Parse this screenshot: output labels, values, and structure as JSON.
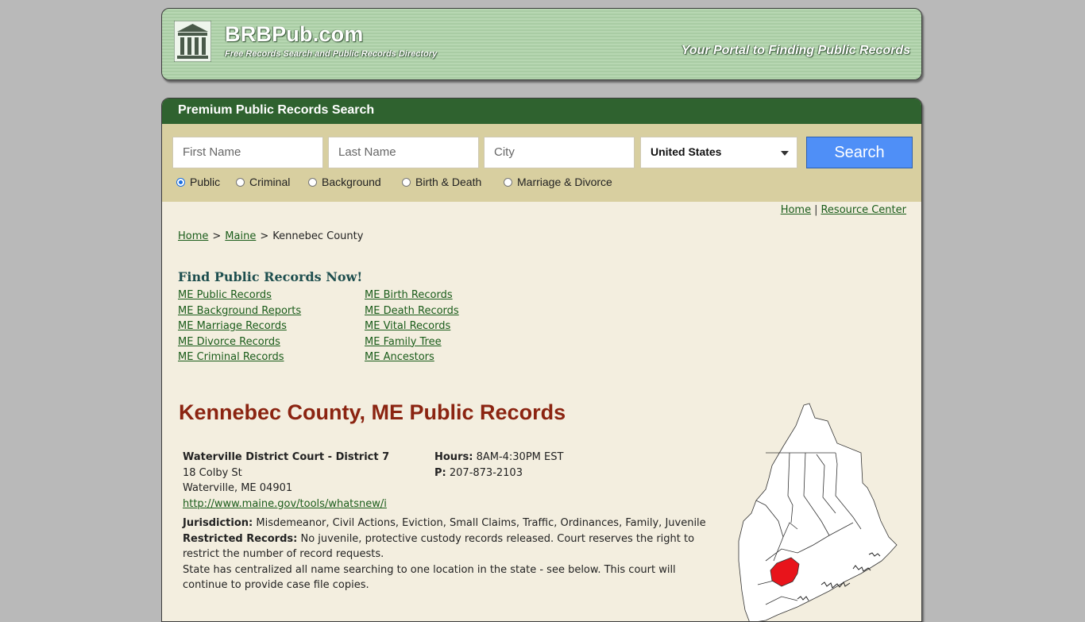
{
  "header": {
    "site_name": "BRBPub.com",
    "site_subtitle": "Free Records Search and Public Records Directory",
    "tagline": "Your Portal to Finding Public Records"
  },
  "search": {
    "title": "Premium Public Records Search",
    "first_name_placeholder": "First Name",
    "last_name_placeholder": "Last Name",
    "city_placeholder": "City",
    "country_selected": "United States",
    "button_label": "Search",
    "record_types": [
      {
        "label": "Public",
        "selected": true
      },
      {
        "label": "Criminal",
        "selected": false
      },
      {
        "label": "Background",
        "selected": false
      },
      {
        "label": "Birth & Death",
        "selected": false
      },
      {
        "label": "Marriage & Divorce",
        "selected": false
      }
    ]
  },
  "top_links": {
    "home": "Home",
    "separator": "|",
    "resource_center": "Resource Center"
  },
  "breadcrumb": {
    "home": "Home",
    "state": "Maine",
    "current": "Kennebec County",
    "separator": ">"
  },
  "find_records": {
    "title": "Find Public Records Now!",
    "left_links": [
      "ME Public Records",
      "ME Background Reports",
      "ME Marriage Records",
      "ME Divorce Records",
      "ME Criminal Records"
    ],
    "right_links": [
      "ME Birth Records",
      "ME Death Records",
      "ME Vital Records",
      "ME Family Tree",
      "ME Ancestors"
    ]
  },
  "county": {
    "title": "Kennebec County, ME Public Records",
    "court_name": "Waterville District Court - District 7",
    "address_line1": "18 Colby St",
    "address_line2": "Waterville, ME 04901",
    "url": "http://www.maine.gov/tools/whatsnew/i",
    "hours_label": "Hours:",
    "hours_value": "8AM-4:30PM EST",
    "phone_label": "P:",
    "phone_value": "207-873-2103",
    "jurisdiction_label": "Jurisdiction:",
    "jurisdiction_value": "Misdemeanor, Civil Actions, Eviction, Small Claims, Traffic, Ordinances, Family, Juvenile",
    "restricted_label": "Restricted Records:",
    "restricted_value": "No juvenile, protective custody records released. Court reserves the right to restrict the number of record requests.",
    "note": "State has centralized all name searching to one location in the state - see below. This court will continue to provide case file copies."
  },
  "colors": {
    "header_green": "#b7d7b2",
    "search_bar": "#2f622f",
    "search_box": "#d8cfa0",
    "panel_bg": "#f3eedf",
    "county_title": "#8b2411",
    "highlight_county": "#e8141b",
    "search_button": "#4f8ff7"
  }
}
